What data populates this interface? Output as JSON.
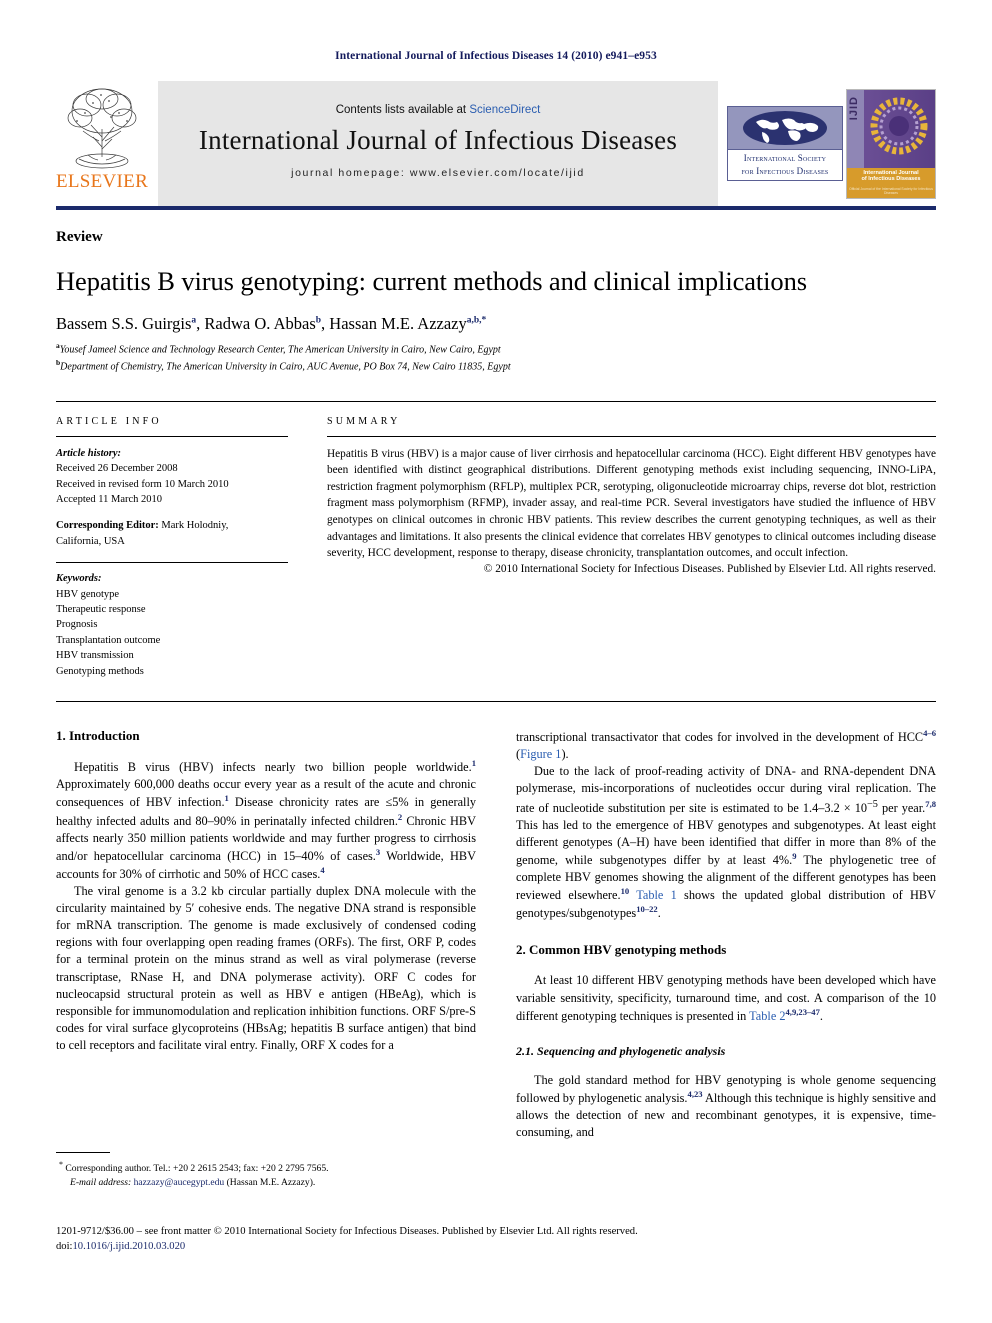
{
  "running_head": "International Journal of Infectious Diseases 14 (2010) e941–e953",
  "masthead": {
    "publisher_name": "ELSEVIER",
    "contents_prefix": "Contents lists available at ",
    "contents_link": "ScienceDirect",
    "journal_name": "International Journal of Infectious Diseases",
    "homepage": "journal homepage: www.elsevier.com/locate/ijid",
    "society_line1": "International Society",
    "society_line2": "for Infectious Diseases",
    "cover_spine": "IJID",
    "cover_title_line1": "International Journal",
    "cover_title_line2": "of Infectious Diseases",
    "cover_sub": "Official Journal of the International Society for Infectious Diseases"
  },
  "article": {
    "doctype": "Review",
    "title": "Hepatitis B virus genotyping: current methods and clinical implications",
    "authors": [
      {
        "name": "Bassem S.S. Guirgis",
        "sup": "a",
        "sep": ", "
      },
      {
        "name": "Radwa O. Abbas",
        "sup": "b",
        "sep": ", "
      },
      {
        "name": "Hassan M.E. Azzazy",
        "sup": "a,b,*",
        "sep": ""
      }
    ],
    "affiliations": [
      {
        "marker": "a",
        "text": "Yousef Jameel Science and Technology Research Center, The American University in Cairo, New Cairo, Egypt"
      },
      {
        "marker": "b",
        "text": "Department of Chemistry, The American University in Cairo, AUC Avenue, PO Box 74, New Cairo 11835, Egypt"
      }
    ]
  },
  "info": {
    "heading": "Article Info",
    "history_label": "Article history:",
    "history": [
      "Received 26 December 2008",
      "Received in revised form 10 March 2010",
      "Accepted 11 March 2010"
    ],
    "corresponding_editor_label": "Corresponding Editor:",
    "corresponding_editor": " Mark Holodniy,",
    "corresponding_editor_line2": "California, USA",
    "keywords_label": "Keywords:",
    "keywords": [
      "HBV genotype",
      "Therapeutic response",
      "Prognosis",
      "Transplantation outcome",
      "HBV transmission",
      "Genotyping methods"
    ]
  },
  "summary": {
    "heading": "Summary",
    "text": "Hepatitis B virus (HBV) is a major cause of liver cirrhosis and hepatocellular carcinoma (HCC). Eight different HBV genotypes have been identified with distinct geographical distributions. Different genotyping methods exist including sequencing, INNO-LiPA, restriction fragment polymorphism (RFLP), multiplex PCR, serotyping, oligonucleotide microarray chips, reverse dot blot, restriction fragment mass polymorphism (RFMP), invader assay, and real-time PCR. Several investigators have studied the influence of HBV genotypes on clinical outcomes in chronic HBV patients. This review describes the current genotyping techniques, as well as their advantages and limitations. It also presents the clinical evidence that correlates HBV genotypes to clinical outcomes including disease severity, HCC development, response to therapy, disease chronicity, transplantation outcomes, and occult infection.",
    "copyright": "© 2010 International Society for Infectious Diseases. Published by Elsevier Ltd. All rights reserved."
  },
  "body": {
    "intro_heading": "1. Introduction",
    "intro_p1_a": "Hepatitis B virus (HBV) infects nearly two billion people worldwide.",
    "intro_p1_r1": "1",
    "intro_p1_b": " Approximately 600,000 deaths occur every year as a result of the acute and chronic consequences of HBV infection.",
    "intro_p1_r2": "1",
    "intro_p1_c": " Disease chronicity rates are ≤5% in generally healthy infected adults and 80–90% in perinatally infected children.",
    "intro_p1_r3": "2",
    "intro_p1_d": " Chronic HBV affects nearly 350 million patients worldwide and may further progress to cirrhosis and/or hepatocellular carcinoma (HCC) in 15–40% of cases.",
    "intro_p1_r4": "3",
    "intro_p1_e": " Worldwide, HBV accounts for 30% of cirrhotic and 50% of HCC cases.",
    "intro_p1_r5": "4",
    "intro_p2": "The viral genome is a 3.2 kb circular partially duplex DNA molecule with the circularity maintained by 5′ cohesive ends. The negative DNA strand is responsible for mRNA transcription. The genome is made exclusively of condensed coding regions with four overlapping open reading frames (ORFs). The first, ORF P, codes for a terminal protein on the minus strand as well as viral polymerase (reverse transcriptase, RNase H, and DNA polymerase activity). ORF C codes for nucleocapsid structural protein as well as HBV e antigen (HBeAg), which is responsible for immunomodulation and replication inhibition functions. ORF S/pre-S codes for viral surface glycoproteins (HBsAg; hepatitis B surface antigen) that bind to cell receptors and facilitate viral entry. Finally, ORF X codes for a",
    "right_p1_a": "transcriptional transactivator that codes for involved in the development of HCC",
    "right_p1_r1": "4–6",
    "right_p1_figlink": "Figure 1",
    "right_p1_b": " (",
    "right_p1_c": ").",
    "right_p2_a": "Due to the lack of proof-reading activity of DNA- and RNA-dependent DNA polymerase, mis-incorporations of nucleotides occur during viral replication. The rate of nucleotide substitution per site is estimated to be 1.4–3.2 × 10",
    "right_p2_exp": "−5",
    "right_p2_b": " per year.",
    "right_p2_r1": "7,8",
    "right_p2_c": " This has led to the emergence of HBV genotypes and subgenotypes. At least eight different genotypes (A–H) have been identified that differ in more than 8% of the genome, while subgenotypes differ by at least 4%.",
    "right_p2_r2": "9",
    "right_p2_d": " The phylogenetic tree of complete HBV genomes showing the alignment of the different genotypes has been reviewed elsewhere.",
    "right_p2_r3": "10",
    "right_p2_tablelink": "Table 1",
    "right_p2_e": " shows the updated global distribution of HBV genotypes/subgenotypes",
    "right_p2_r4": "10–22",
    "right_p2_f": ".",
    "methods_heading": "2. Common HBV genotyping methods",
    "methods_p1_a": "At least 10 different HBV genotyping methods have been developed which have variable sensitivity, specificity, turnaround time, and cost. A comparison of the 10 different genotyping techniques is presented in ",
    "methods_p1_tablelink": "Table 2",
    "methods_p1_r1": "4,9,23–47",
    "methods_p1_b": ".",
    "sub_heading": "2.1. Sequencing and phylogenetic analysis",
    "sub_p1_a": "The gold standard method for HBV genotyping is whole genome sequencing followed by phylogenetic analysis.",
    "sub_p1_r1": "4,23",
    "sub_p1_b": " Although this technique is highly sensitive and allows the detection of new and recombinant genotypes, it is expensive, time-consuming, and"
  },
  "footnote": {
    "marker": "*",
    "line1": " Corresponding author. Tel.: +20 2 2615 2543; fax: +20 2 2795 7565.",
    "email_label": "E-mail address:",
    "email": "hazzazy@aucegypt.edu",
    "email_tail": " (Hassan M.E. Azzazy)."
  },
  "footer": {
    "line1": "1201-9712/$36.00 – see front matter © 2010 International Society for Infectious Diseases. Published by Elsevier Ltd. All rights reserved.",
    "doi_label": "doi:",
    "doi": "10.1016/j.ijid.2010.03.020"
  }
}
